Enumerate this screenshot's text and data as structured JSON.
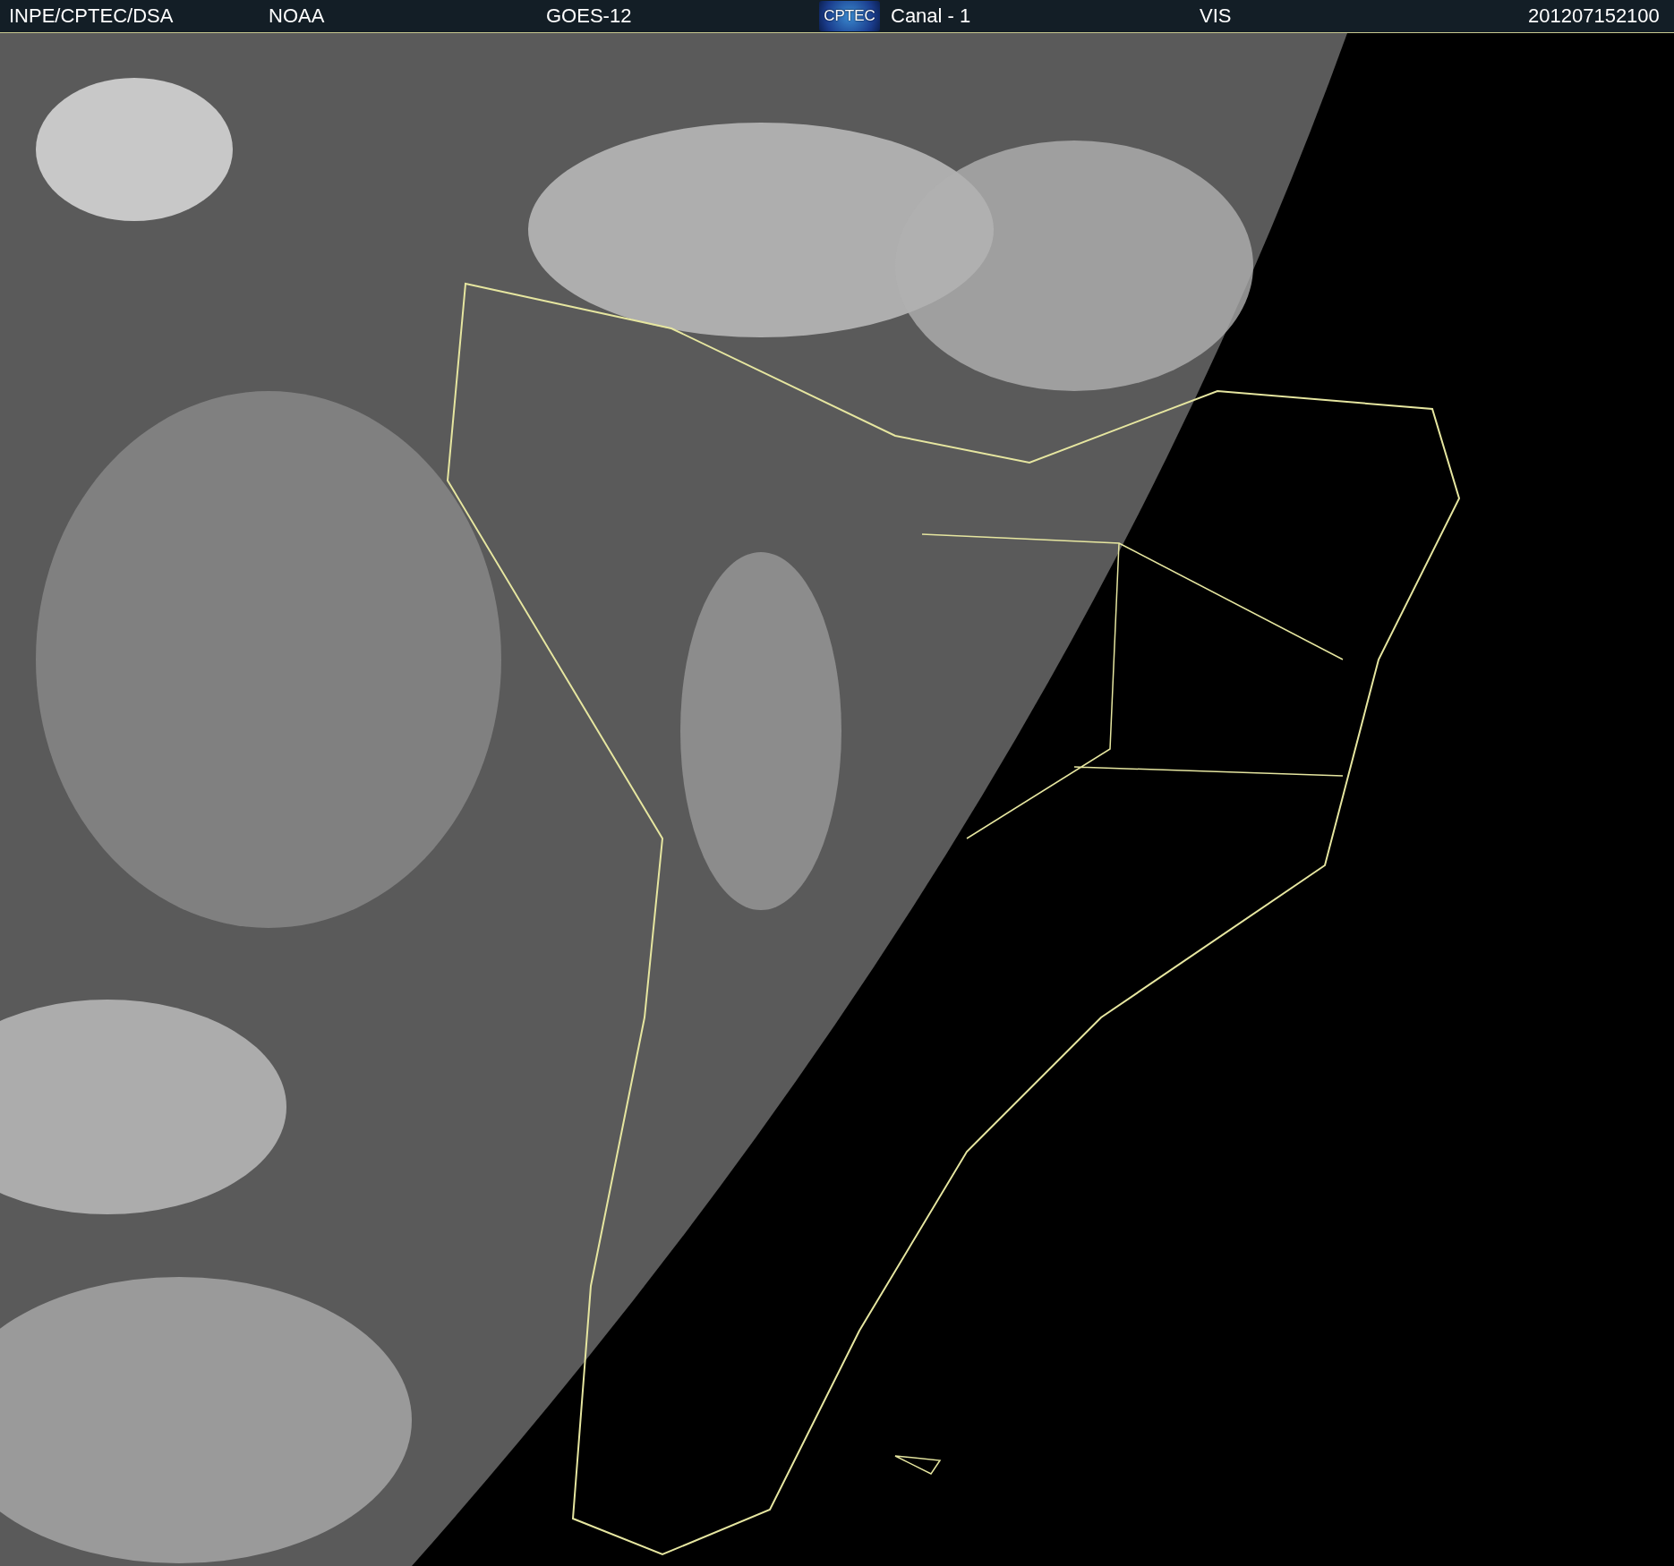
{
  "header": {
    "items": [
      {
        "text": "INPE/CPTEC/DSA"
      },
      {
        "text": "NOAA"
      },
      {
        "text": "GOES-12"
      }
    ],
    "logo": {
      "text": "CPTEC"
    },
    "items_right": [
      {
        "text": "Canal - 1"
      },
      {
        "text": "VIS"
      },
      {
        "text": "201207152100"
      }
    ]
  }
}
